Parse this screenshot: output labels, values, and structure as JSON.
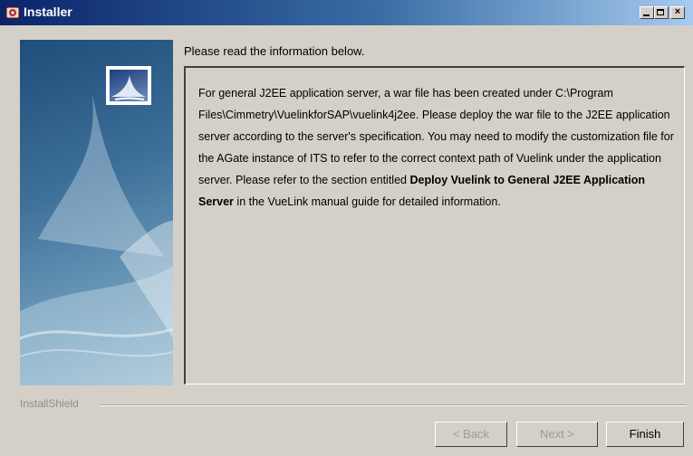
{
  "window": {
    "title": "Installer"
  },
  "content": {
    "instructions": "Please read the information below.",
    "paragraph_1": "For general J2EE application server, a war file has been created under C:\\Program Files\\Cimmetry\\VuelinkforSAP\\vuelink4j2ee. Please deploy the war file to the J2EE application server according to the server's specification. You may need to modify the customization file for the AGate instance of ITS to refer to the correct context path of Vuelink under the application server. Please refer to the section entitled ",
    "bold_phrase": "Deploy Vuelink to General J2EE Application Server",
    "paragraph_2": " in the VueLink manual guide for detailed information."
  },
  "footer": {
    "brand": "InstallShield",
    "back_label": "< Back",
    "next_label": "Next >",
    "finish_label": "Finish"
  },
  "icons": {
    "app": "installer-icon",
    "minimize": "minimize-icon",
    "maximize": "maximize-icon",
    "close": "close-icon",
    "logo": "product-logo-icon"
  }
}
